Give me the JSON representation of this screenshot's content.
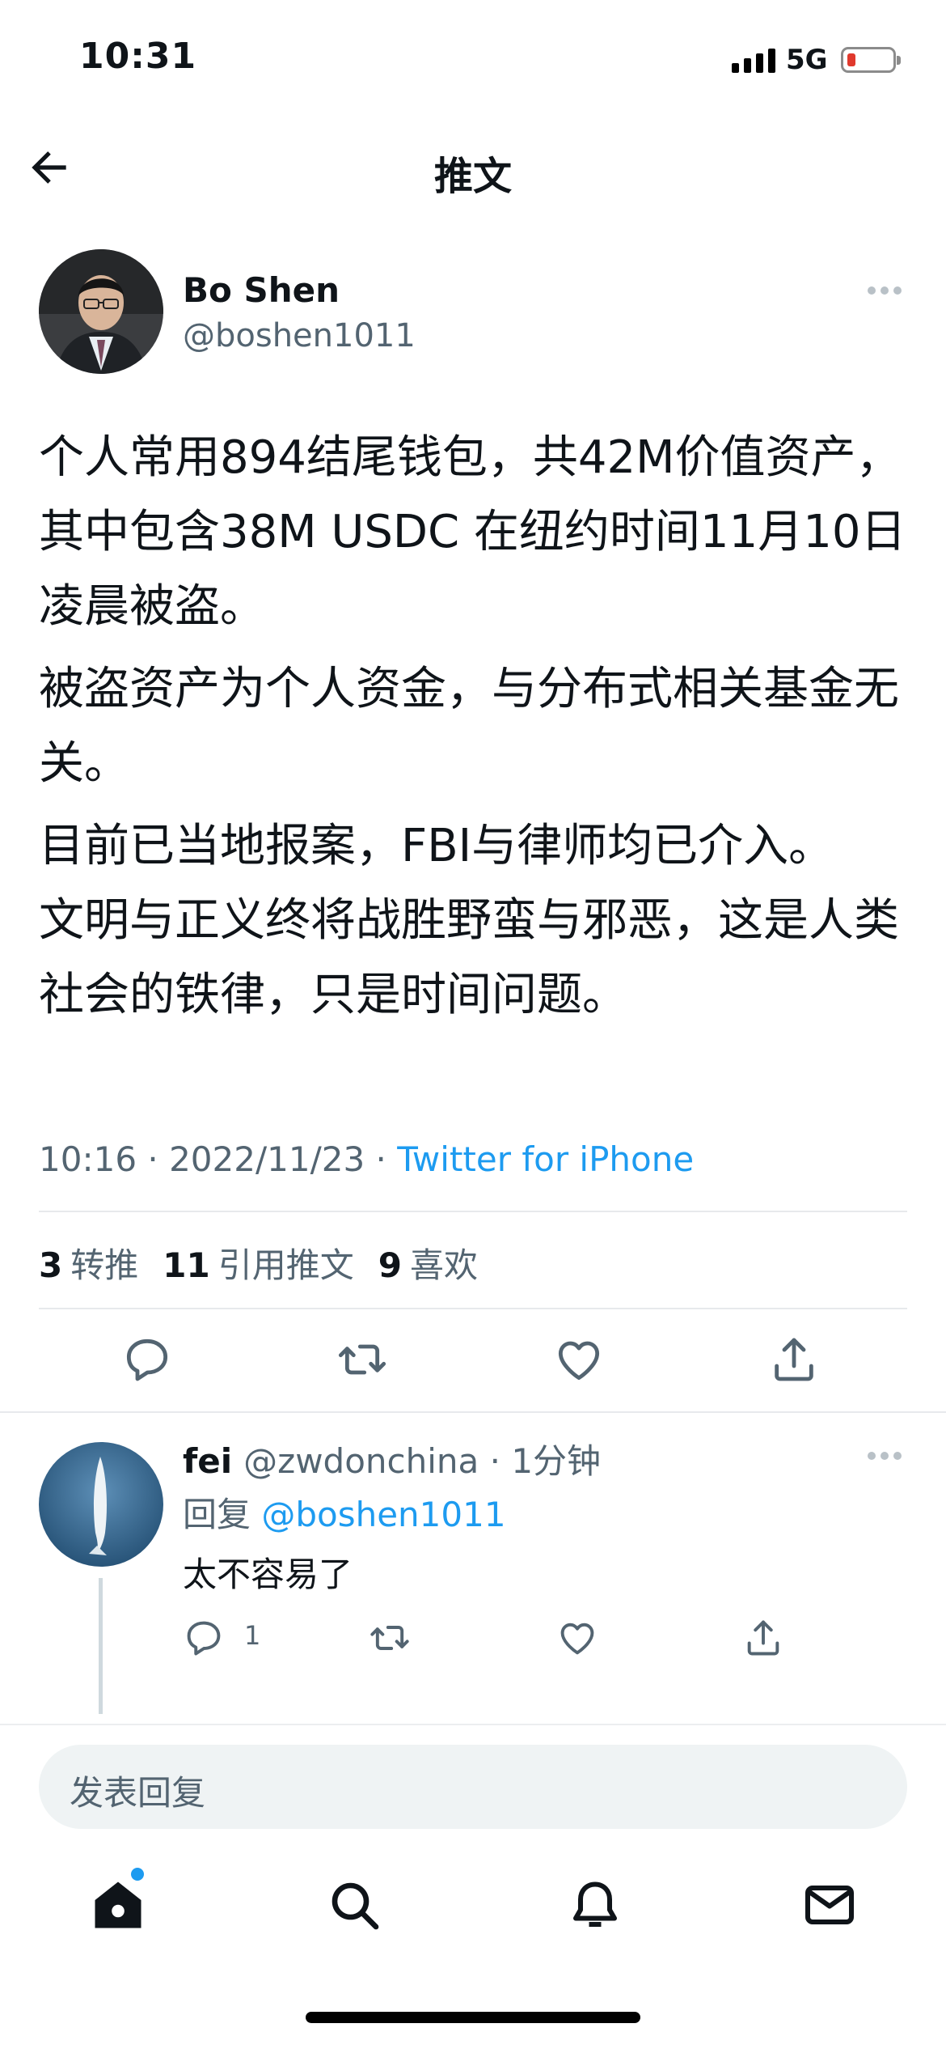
{
  "status_bar": {
    "time": "10:31",
    "network": "5G"
  },
  "nav": {
    "title": "推文"
  },
  "tweet": {
    "author_name": "Bo Shen",
    "author_handle": "@boshen1011",
    "paragraphs": [
      "个人常用894结尾钱包，共42M价值资产，其中包含38M USDC 在纽约时间11月10日凌晨被盗。",
      "被盗资产为个人资金，与分布式相关基金无关。",
      "目前已当地报案，FBI与律师均已介入。",
      "文明与正义终将战胜野蛮与邪恶，这是人类社会的铁律，只是时间问题。"
    ],
    "timestamp": "10:16 · 2022/11/23 · ",
    "source": "Twitter for iPhone",
    "stats": {
      "retweets_count": "3",
      "retweets_label": "转推",
      "quotes_count": "11",
      "quotes_label": "引用推文",
      "likes_count": "9",
      "likes_label": "喜欢"
    }
  },
  "reply": {
    "name": "fei",
    "handle_time": "@zwdonchina · 1分钟",
    "reply_prefix": "回复 ",
    "reply_to": "@boshen1011",
    "text": "太不容易了",
    "reply_count": "1"
  },
  "composer": {
    "placeholder": "发表回复"
  },
  "colors": {
    "accent": "#1d9bf0",
    "secondary_text": "#536471",
    "battery_low": "#e0392d"
  }
}
